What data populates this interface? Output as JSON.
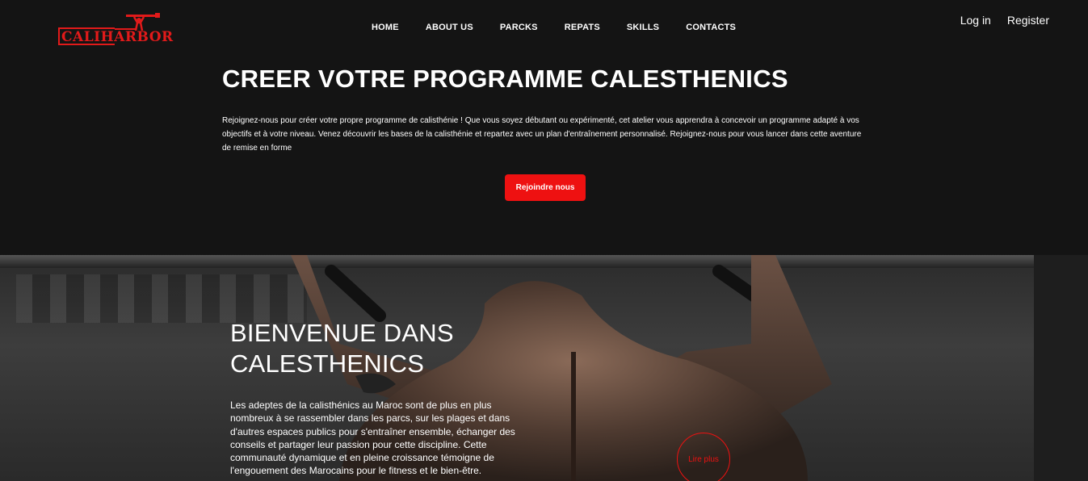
{
  "brand": {
    "name": "CALIHARBOR",
    "accent_color": "#ee1111",
    "logo_icon": "pullup-bar-athlete-icon"
  },
  "nav": {
    "items": [
      {
        "label": "HOME"
      },
      {
        "label": "ABOUT US"
      },
      {
        "label": "PARCKS"
      },
      {
        "label": "REPATS"
      },
      {
        "label": "SKILLS"
      },
      {
        "label": "CONTACTS"
      }
    ]
  },
  "auth": {
    "login_label": "Log in",
    "register_label": "Register"
  },
  "hero": {
    "title": "CREER VOTRE PROGRAMME CALESTHENICS",
    "description": "Rejoignez-nous pour créer votre propre programme de calisthénie ! Que vous soyez débutant ou expérimenté, cet atelier vous apprendra à concevoir un programme adapté à vos objectifs et à votre niveau. Venez découvrir les bases de la calisthénie et repartez avec un plan d'entraînement personnalisé. Rejoignez-nous pour vous lancer dans cette aventure de remise en forme",
    "cta_label": "Rejoindre nous"
  },
  "welcome": {
    "title_line1": "BIENVENUE DANS",
    "title_line2": "CALESTHENICS",
    "description": "Les adeptes de la calisthénics au Maroc sont de plus en plus nombreux à se rassembler dans les parcs, sur les plages et dans d'autres espaces publics pour s'entraîner ensemble, échanger des conseils et partager leur passion pour cette discipline. Cette communauté dynamique et en pleine croissance témoigne de l'engouement des Marocains pour le fitness et le bien-être.",
    "read_more_label": "Lire plus"
  }
}
